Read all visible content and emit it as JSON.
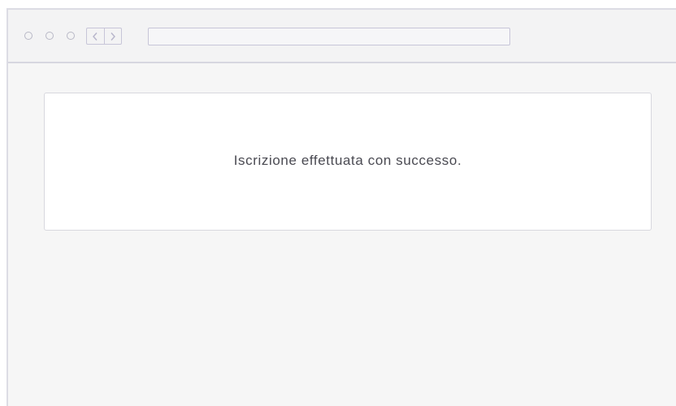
{
  "browser": {
    "controls": [
      "close-dot",
      "minimize-dot",
      "maximize-dot"
    ],
    "nav": {
      "back_icon": "chevron-left-icon",
      "forward_icon": "chevron-right-icon"
    },
    "address_bar": {
      "value": ""
    }
  },
  "page": {
    "message": "Iscrizione effettuata con successo."
  },
  "colors": {
    "frame_border": "#dcdce4",
    "titlebar_bg": "#f3f3f4",
    "page_bg": "#f6f6f6",
    "card_bg": "#ffffff",
    "text": "#4a4a52"
  }
}
